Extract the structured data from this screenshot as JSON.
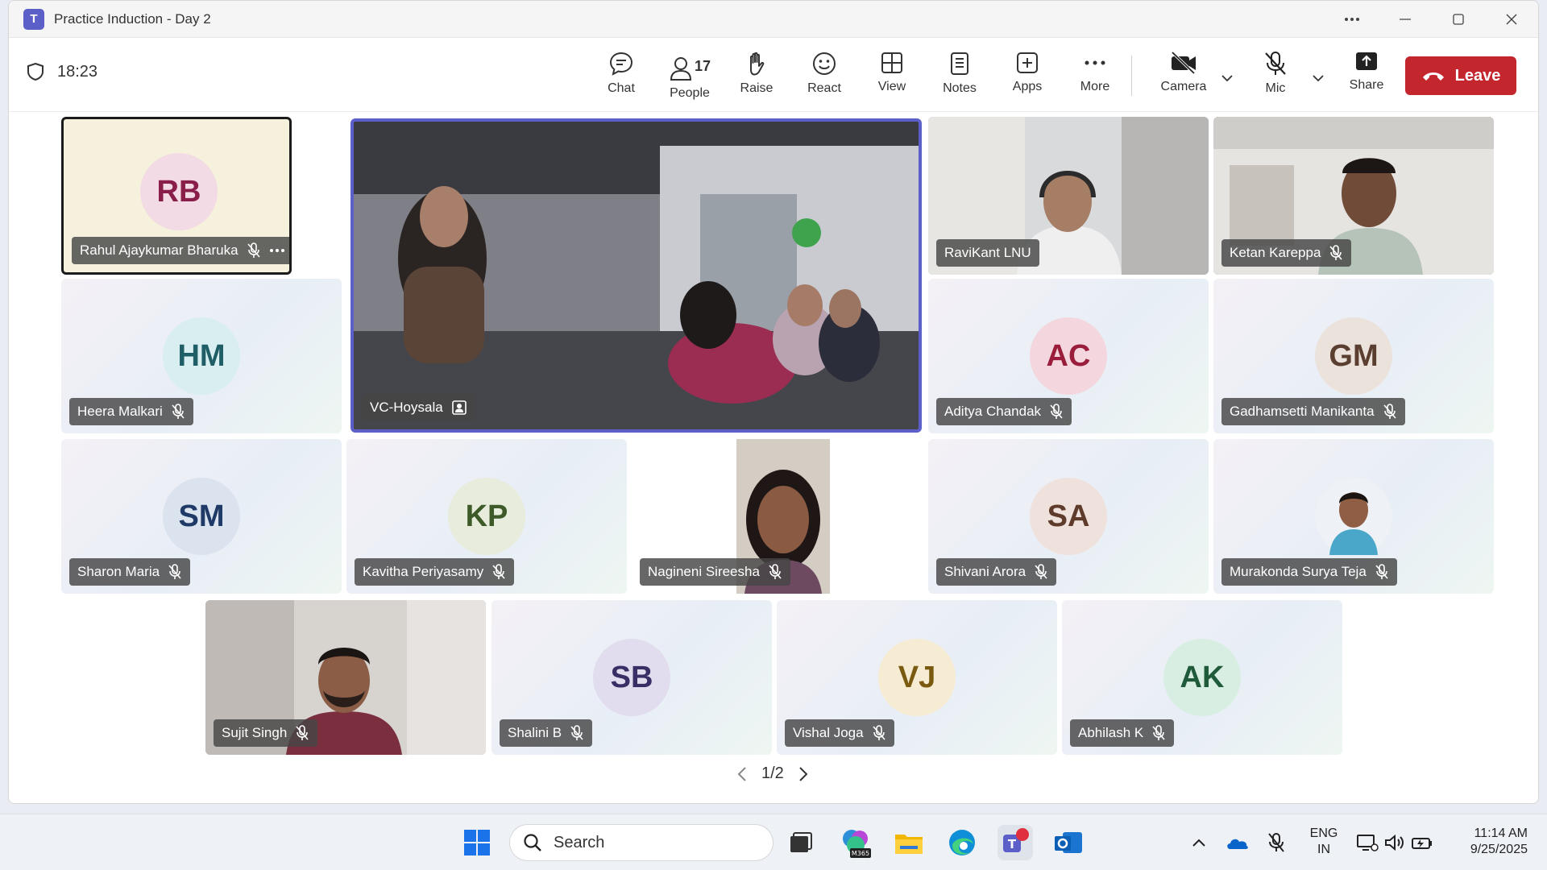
{
  "window": {
    "title": "Practice Induction - Day 2"
  },
  "toolbar": {
    "timer": "18:23",
    "chat": "Chat",
    "people": "People",
    "people_count": "17",
    "raise": "Raise",
    "react": "React",
    "view": "View",
    "notes": "Notes",
    "apps": "Apps",
    "more": "More",
    "camera": "Camera",
    "mic": "Mic",
    "share": "Share",
    "leave": "Leave"
  },
  "participants": [
    {
      "name": "Rahul Ajaykumar Bharuka",
      "initials": "RB",
      "avatar_bg": "#f3dbe6",
      "avatar_fg": "#8a1e4a"
    },
    {
      "name": "VC-Hoysala"
    },
    {
      "name": "RaviKant LNU"
    },
    {
      "name": "Ketan Kareppa"
    },
    {
      "name": "Heera Malkari",
      "initials": "HM",
      "avatar_bg": "#d8eef0",
      "avatar_fg": "#1f5e66"
    },
    {
      "name": "Aditya Chandak",
      "initials": "AC",
      "avatar_bg": "#f4d7de",
      "avatar_fg": "#9a1e3c"
    },
    {
      "name": "Gadhamsetti Manikanta",
      "initials": "GM",
      "avatar_bg": "#ebe2dc",
      "avatar_fg": "#5a3e30"
    },
    {
      "name": "Sharon Maria",
      "initials": "SM",
      "avatar_bg": "#dbe3ef",
      "avatar_fg": "#1f3a66"
    },
    {
      "name": "Kavitha Periyasamy",
      "initials": "KP",
      "avatar_bg": "#e7ecdc",
      "avatar_fg": "#3e5a28"
    },
    {
      "name": "Nagineni Sireesha"
    },
    {
      "name": "Shivani Arora",
      "initials": "SA",
      "avatar_bg": "#efe2dc",
      "avatar_fg": "#5e3b2a"
    },
    {
      "name": "Murakonda Surya Teja"
    },
    {
      "name": "Sujit Singh"
    },
    {
      "name": "Shalini B",
      "initials": "SB",
      "avatar_bg": "#e2ddee",
      "avatar_fg": "#3a2e66"
    },
    {
      "name": "Vishal Joga",
      "initials": "VJ",
      "avatar_bg": "#f6ecd4",
      "avatar_fg": "#7a5a10"
    },
    {
      "name": "Abhilash K",
      "initials": "AK",
      "avatar_bg": "#d9eee2",
      "avatar_fg": "#1f5a3a"
    }
  ],
  "pager": {
    "label": "1/2"
  },
  "taskbar": {
    "search_label": "Search",
    "lang_top": "ENG",
    "lang_bottom": "IN",
    "time": "11:14 AM",
    "date": "9/25/2025"
  },
  "colors": {
    "accent": "#5b5fc7",
    "leave": "#c4262e"
  }
}
